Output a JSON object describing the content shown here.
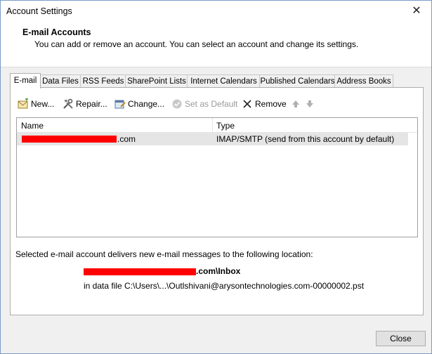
{
  "window": {
    "title": "Account Settings",
    "close_glyph": "✕"
  },
  "header": {
    "title": "E-mail Accounts",
    "description": "You can add or remove an account. You can select an account and change its settings."
  },
  "tabs": [
    {
      "label": "E-mail",
      "active": true
    },
    {
      "label": "Data Files"
    },
    {
      "label": "RSS Feeds"
    },
    {
      "label": "SharePoint Lists"
    },
    {
      "label": "Internet Calendars"
    },
    {
      "label": "Published Calendars"
    },
    {
      "label": "Address Books"
    }
  ],
  "toolbar": {
    "new_label": "New...",
    "repair_label": "Repair...",
    "change_label": "Change...",
    "set_default_label": "Set as Default",
    "remove_label": "Remove"
  },
  "list": {
    "columns": [
      "Name",
      "Type"
    ],
    "rows": [
      {
        "name_suffix": ".com",
        "type": "IMAP/SMTP (send from this account by default)"
      }
    ]
  },
  "delivery": {
    "text": "Selected e-mail account delivers new e-mail messages to the following location:",
    "inbox_suffix": ".com\\Inbox",
    "data_file": "in data file C:\\Users\\...\\Outlshivani@arysontechnologies.com-00000002.pst"
  },
  "buttons": {
    "close_label": "Close"
  },
  "colors": {
    "redaction": "#ff0000",
    "selection": "#e5e5e5",
    "window_border": "#7a9cc7"
  }
}
